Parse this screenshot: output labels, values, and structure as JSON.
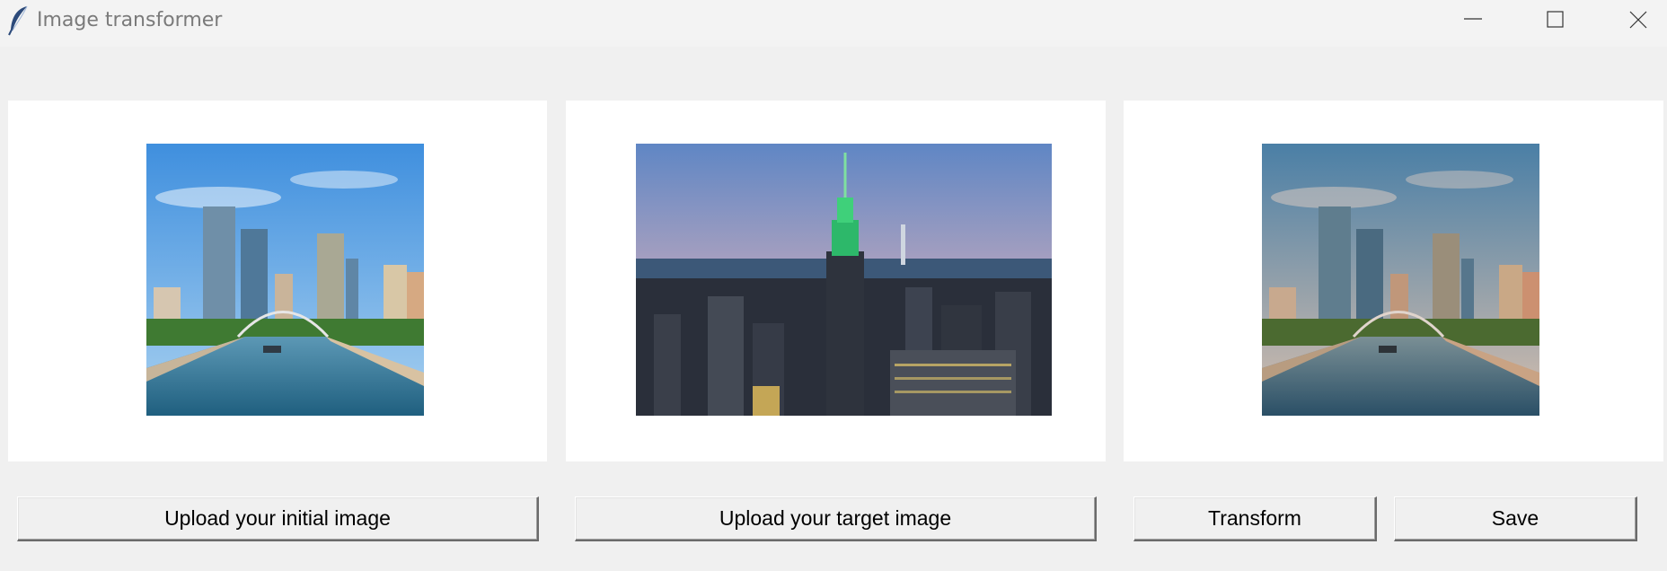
{
  "window": {
    "title": "Image transformer",
    "controls": [
      "minimize-icon",
      "maximize-icon",
      "close-icon"
    ],
    "app_icon": "feather-icon"
  },
  "panels": [
    {
      "image": "Daytime city skyline with glass towers, a pedestrian arch bridge and a canal under blue sky"
    },
    {
      "image": "Empire State Building with green-lit spire over Manhattan at dusk"
    },
    {
      "image": "Transformed city skyline with canal and arch bridge in warmer, muted tones"
    }
  ],
  "buttons": {
    "upload_initial": "Upload your initial image",
    "upload_target": "Upload your target image",
    "transform": "Transform",
    "save": "Save"
  },
  "colors": {
    "background": "#f0f0f0",
    "panel": "#ffffff",
    "title_text": "#7a7a7a"
  }
}
